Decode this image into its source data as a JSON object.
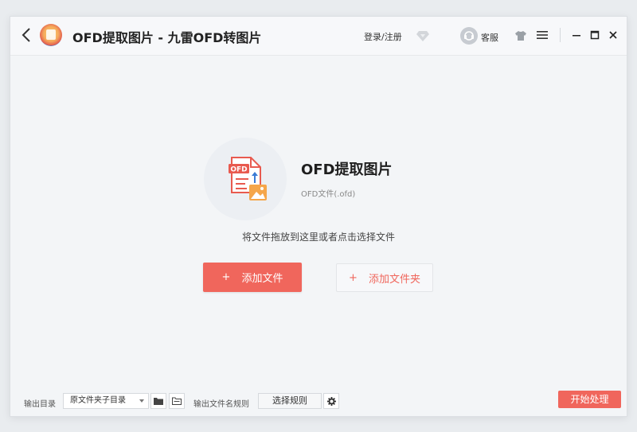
{
  "header": {
    "title": "OFD提取图片 - 九雷OFD转图片",
    "login_label": "登录/注册",
    "service_label": "客服"
  },
  "hero": {
    "title": "OFD提取图片",
    "subtitle": "OFD文件(.ofd)",
    "file_badge": "OFD",
    "hint": "将文件拖放到这里或者点击选择文件"
  },
  "actions": {
    "plus": "+",
    "add_file_label": "添加文件",
    "add_folder_label": "添加文件夹"
  },
  "footer": {
    "output_dir_label": "输出目录",
    "output_dir_value": "原文件夹子目录",
    "filename_rule_label": "输出文件名规则",
    "select_rule_label": "选择规则",
    "start_label": "开始处理"
  },
  "colors": {
    "accent": "#f0665c",
    "window_bg": "#f3f5f7"
  }
}
